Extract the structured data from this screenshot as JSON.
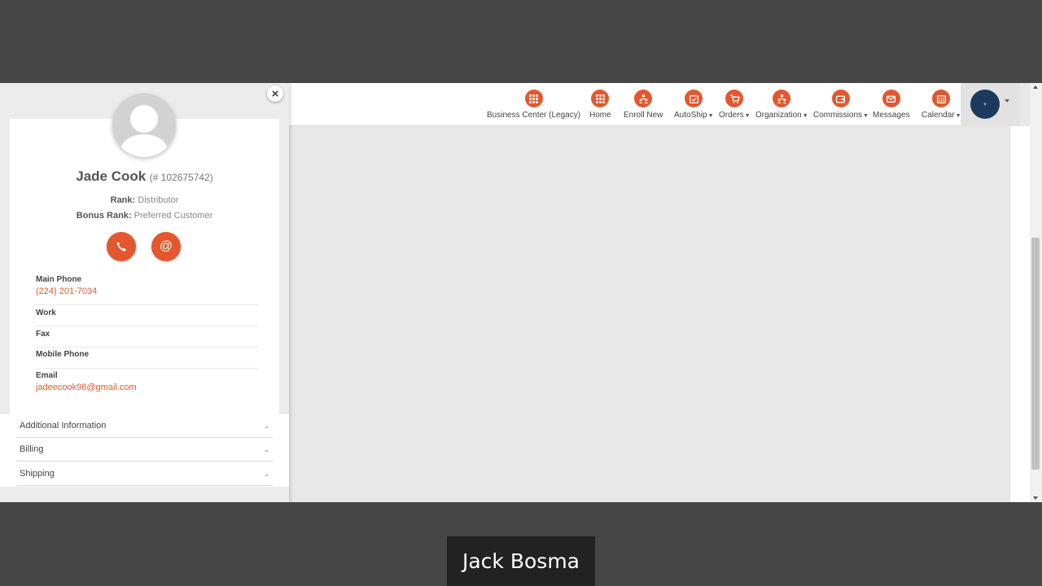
{
  "nav": {
    "items": [
      {
        "label": "Business Center (Legacy)",
        "icon": "grid-icon",
        "caret": false
      },
      {
        "label": "Home",
        "icon": "grid-icon",
        "caret": false
      },
      {
        "label": "Enroll New",
        "icon": "people-icon",
        "caret": false
      },
      {
        "label": "AutoShip",
        "icon": "calendar-check-icon",
        "caret": true
      },
      {
        "label": "Orders",
        "icon": "cart-icon",
        "caret": true
      },
      {
        "label": "Organization",
        "icon": "org-chart-icon",
        "caret": true
      },
      {
        "label": "Commissions",
        "icon": "wallet-icon",
        "caret": true
      },
      {
        "label": "Messages",
        "icon": "envelope-icon",
        "caret": false
      },
      {
        "label": "Calendar",
        "icon": "calendar-icon",
        "caret": true
      }
    ],
    "accent_color": "#e4572e"
  },
  "profile": {
    "name": "Jade Cook",
    "member_id": "(# 102675742)",
    "rank_label": "Rank:",
    "rank_value": "Distributor",
    "bonus_rank_label": "Bonus Rank:",
    "bonus_rank_value": "Preferred Customer",
    "call_icon": "phone-icon",
    "email_symbol": "@",
    "fields": {
      "main_phone_label": "Main Phone",
      "main_phone_value": "(224) 201-7034",
      "work_label": "Work",
      "fax_label": "Fax",
      "mobile_label": "Mobile Phone",
      "email_label": "Email",
      "email_value": "jadeecook98@gmail.com"
    }
  },
  "sections": {
    "additional": "Additional Information",
    "billing": "Billing",
    "shipping": "Shipping"
  },
  "close_symbol": "×",
  "caption": "Jack Bosma"
}
